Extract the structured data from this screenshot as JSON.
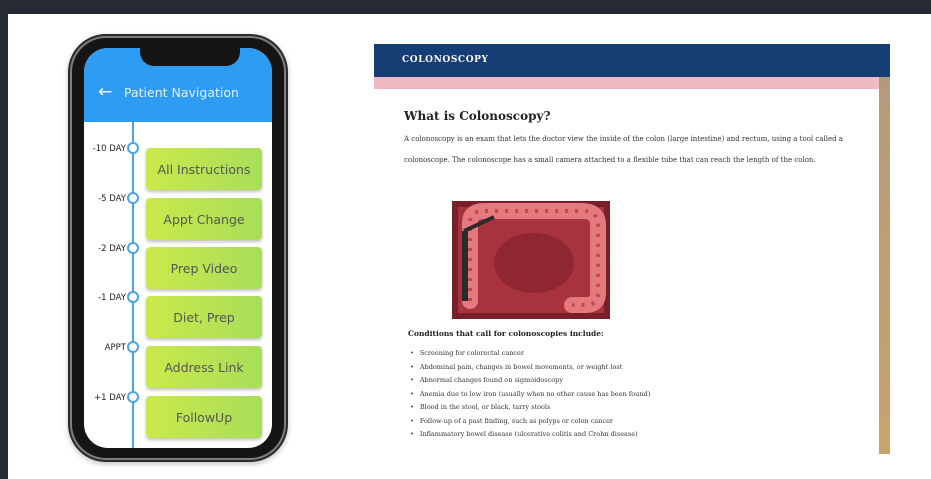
{
  "phone": {
    "header": {
      "back_icon": "arrow-left-icon",
      "title": "Patient Navigation",
      "color": "#2f9cf3"
    },
    "timeline": [
      {
        "day": "-10 DAY",
        "task": "All Instructions"
      },
      {
        "day": "-5 DAY",
        "task": "Appt Change"
      },
      {
        "day": "-2 DAY",
        "task": "Prep Video"
      },
      {
        "day": "-1 DAY",
        "task": "Diet, Prep"
      },
      {
        "day": "APPT",
        "task": "Address Link"
      },
      {
        "day": "+1 DAY",
        "task": "FollowUp"
      }
    ]
  },
  "document": {
    "header_title": "COLONOSCOPY",
    "header_color": "#163e74",
    "heading": "What is Colonoscopy?",
    "paragraph": "A colonoscopy is an exam that lets the doctor view the inside of the colon (large intestine) and rectum, using a tool called a colonoscope. The colonoscope has a small camera attached to a flexible tube that can reach the length of the colon.",
    "conditions_heading": "Conditions that call for colonoscopies include:",
    "conditions": [
      "Screening for colorectal cancer",
      "Abdominal pain, changes in bowel movements, or weight lost",
      "Abnormal changes found on sigmoidoscopy",
      "Anemia due to low iron (usually when no other cause has been found)",
      "Blood in the stool, or black, tarry stools",
      "Follow-up of a past finding, such as polyps or colon cancer",
      "Inflammatory bowel disease (ulcerative colitis and Crohn disease)"
    ]
  }
}
